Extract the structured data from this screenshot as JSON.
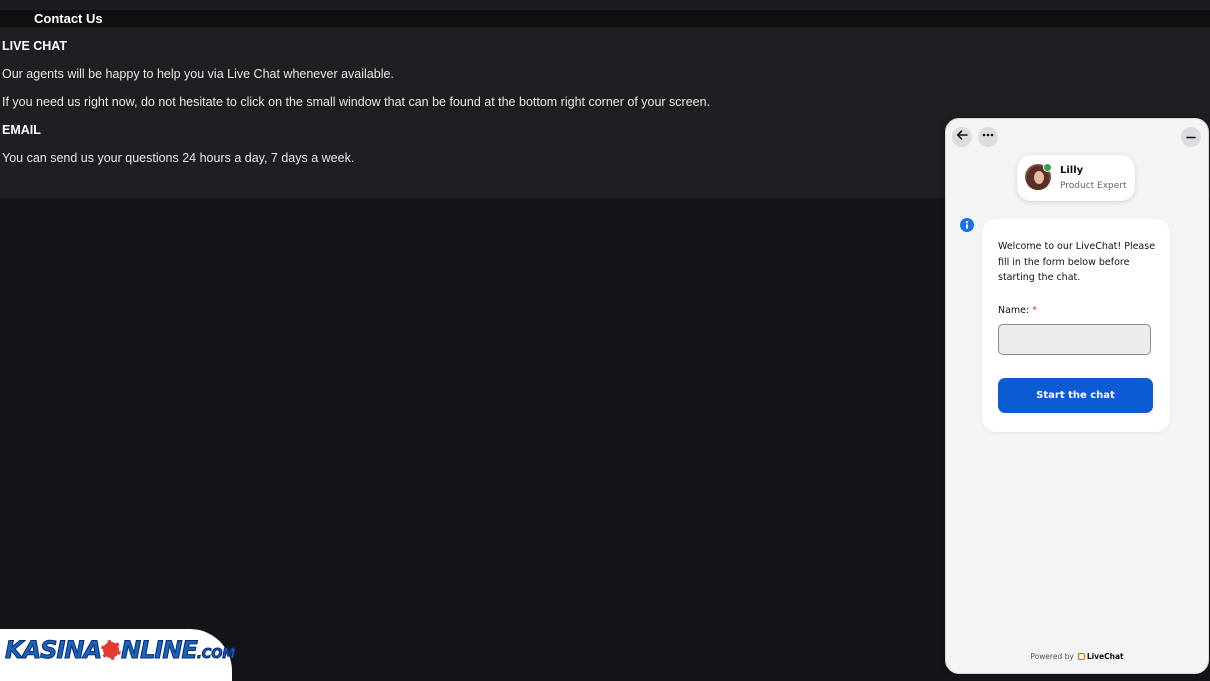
{
  "header": {
    "title": "Contact Us"
  },
  "content": {
    "live_chat_heading": "LIVE CHAT",
    "live_chat_line1": "Our agents will be happy to help you via Live Chat whenever available.",
    "live_chat_line2": "If you need us right now, do not hesitate to click on the small window that can be found at the bottom right corner of your screen.",
    "email_heading": "EMAIL",
    "email_line1": "You can send us your questions 24 hours a day, 7 days a week."
  },
  "chat": {
    "back_icon": "arrow-left-icon",
    "menu_icon": "ellipsis-icon",
    "minimize_icon": "minimize-icon",
    "agent_name": "Lilly",
    "agent_role": "Product Expert",
    "welcome_message": "Welcome to our LiveChat! Please fill in the form below before starting the chat.",
    "name_label": "Name:",
    "required_mark": "*",
    "name_value": "",
    "start_button": "Start the chat",
    "powered_by": "Powered by",
    "brand": "LiveChat"
  },
  "logo": {
    "part1": "KASINA",
    "part2": "NLINE",
    "suffix": ".COM"
  },
  "colors": {
    "accent": "#0b5bd3",
    "online": "#2ea44f",
    "page_bg": "#141518",
    "info": "#1a73e8"
  }
}
